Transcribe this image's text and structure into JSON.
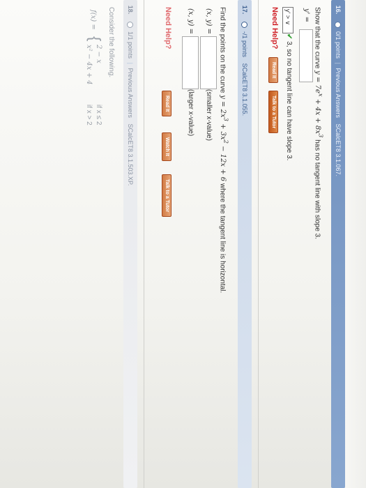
{
  "q16": {
    "number": "16.",
    "points": "0/1 points",
    "previous": "Previous Answers",
    "source": "SCalcET8 3.1.067.",
    "prompt_start": "Show that the curve",
    "equation": "y = 7e",
    "eq_exp": "x",
    "eq_rest": " + 4x + 8x",
    "eq_exp2": "3",
    "prompt_end": "has no tangent line with slope 3.",
    "yprime_label": "y' =",
    "yprime_value": "",
    "compare_sel": "y' > ∨",
    "compare_text": "3, so no tangent line can have slope 3.",
    "need_help": "Need Help?",
    "read_it": "Read It",
    "talk_tutor": "Talk to a Tutor"
  },
  "q17": {
    "number": "17.",
    "points": "-/1 points",
    "source": "SCalcET8 3.1.055.",
    "prompt_start": "Find the points on the curve",
    "equation": "y = 2x",
    "eq_exp1": "3",
    "eq_mid": " + 3x",
    "eq_exp2": "2",
    "eq_rest": " − 12x + 6",
    "prompt_end": "where the tangent line is horizontal.",
    "point1_label": "(x, y) =",
    "point1_value": "",
    "point1_note": "(smaller x-value)",
    "point2_label": "(x, y) =",
    "point2_value": "",
    "point2_note": "(larger x-value)",
    "need_help": "Need Help?",
    "read_it": "Read It",
    "watch_it": "Watch It",
    "talk_tutor": "Talk to a Tutor"
  },
  "q18": {
    "number": "18.",
    "points": "1/1 points",
    "previous": "Previous Answers",
    "source": "SCalcET8 3.1.503.XP.",
    "prompt": "Consider the following.",
    "func_label": "f(x) =",
    "piece1": "2 − x",
    "cond1": "if x ≤ 2",
    "piece2": "x² − 4x + 4",
    "cond2": "if x > 2"
  }
}
